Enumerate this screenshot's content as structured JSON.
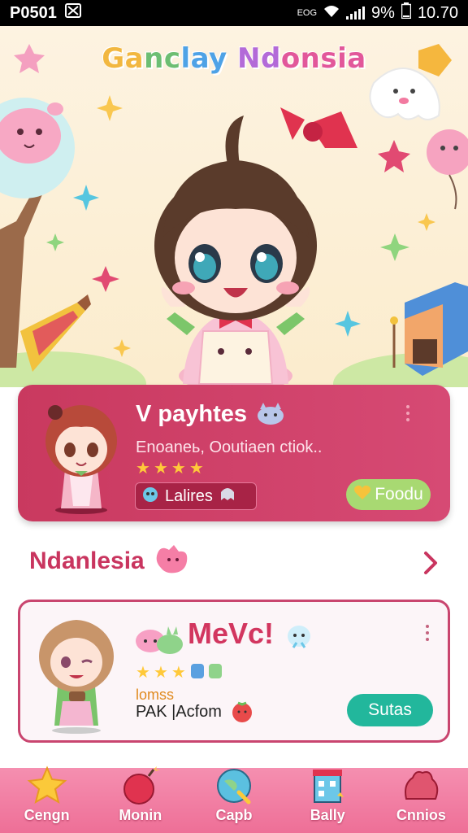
{
  "status_bar": {
    "carrier": "P0501",
    "network": "EOG",
    "battery": "9%",
    "time": "10.70"
  },
  "hero": {
    "title_parts": [
      "Ga",
      "nc",
      "lay ",
      "Nd",
      "onsia"
    ]
  },
  "featured_card": {
    "title": "V payhtes",
    "subtitle": "Enoaneь, Ooutiaen ctiok..",
    "stars": [
      "★",
      "★",
      "★",
      "★"
    ],
    "tag_label": "Lalires",
    "button_label": "Foodu"
  },
  "section": {
    "title": "Ndanlesia"
  },
  "game_card": {
    "title": "MeVc!",
    "stars": [
      "★",
      "★",
      "★"
    ],
    "tag": "lomss",
    "subtitle": "PAK |Acfom",
    "button_label": "Sutas"
  },
  "bottom_nav": {
    "items": [
      {
        "label": "Cengn",
        "icon": "star-icon"
      },
      {
        "label": "Monin",
        "icon": "bomb-icon"
      },
      {
        "label": "Capb",
        "icon": "globe-icon"
      },
      {
        "label": "Bally",
        "icon": "building-icon"
      },
      {
        "label": "Cnnios",
        "icon": "blob-icon"
      }
    ]
  },
  "colors": {
    "accent": "#c9395f",
    "nav_bg": "#ee6f97",
    "play_button": "#22b79c",
    "featured_button": "#a8d972"
  }
}
